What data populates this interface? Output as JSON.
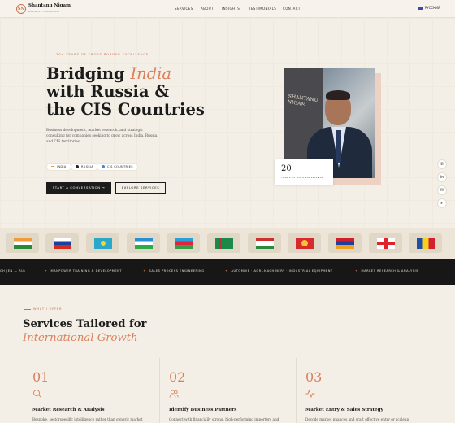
{
  "nav": {
    "logo_mark": "SN",
    "name": "Shantanu Nigam",
    "tagline": "BUSINESS CONSULTANT",
    "items": [
      "SERVICES",
      "ABOUT",
      "INSIGHTS",
      "TESTIMONIALS",
      "CONTACT"
    ],
    "language": "РУССКИЙ"
  },
  "hero": {
    "eyebrow": "20+ YEARS OF CROSS-BORDER EXCELLENCE",
    "title_line1_pre": "Bridging ",
    "title_line1_accent": "India",
    "title_line2": "with Russia &",
    "title_line3": "the CIS Countries",
    "lead": "Business development, market research, and strategic consulting for companies seeking to grow across India, Russia, and CIS territories.",
    "chips": [
      "INDIA",
      "RUSSIA",
      "CIS COUNTRIES"
    ],
    "cta_primary": "START A CONVERSATION  →",
    "cta_secondary": "EXPLORE SERVICES",
    "photo_wall_text": "SHANTANU NIGAM",
    "stat_number": "20",
    "stat_label": "YEARS OF RICH EXPERIENCE"
  },
  "side_icons": [
    "whatsapp-icon",
    "linkedin-icon",
    "email-icon",
    "send-icon"
  ],
  "flags": [
    "india",
    "russia",
    "kazakhstan",
    "uzbekistan",
    "azerbaijan",
    "turkmenistan",
    "tajikistan",
    "kyrgyzstan",
    "armenia",
    "georgia",
    "moldova"
  ],
  "ticker": [
    "CH (EN — RU)",
    "MANPOWER TRAINING & DEVELOPMENT",
    "SALES PROCESS ENGINEERING",
    "AUTOMIVE · AGRI-MACHINERY · INDUSTRIAL EQUIPMENT",
    "MARKET RESEARCH & ANALYSIS"
  ],
  "services": {
    "eyebrow": "WHAT I OFFER",
    "title_line1": "Services Tailored for",
    "title_line2_accent": "International Growth",
    "cards": [
      {
        "num": "01",
        "title": "Market Research & Analysis",
        "text": "Bespoke, sectorspecific intelligence rather than generic market"
      },
      {
        "num": "02",
        "title": "Identify Business Partners",
        "text": "Connect with financially strong, high-performing importers and"
      },
      {
        "num": "03",
        "title": "Market Entry & Sales Strategy",
        "text": "Decode market nuances and craft effective entry or scaleup"
      }
    ]
  },
  "colors": {
    "accent": "#d9805e",
    "dark": "#171717",
    "background": "#f4efe6"
  }
}
